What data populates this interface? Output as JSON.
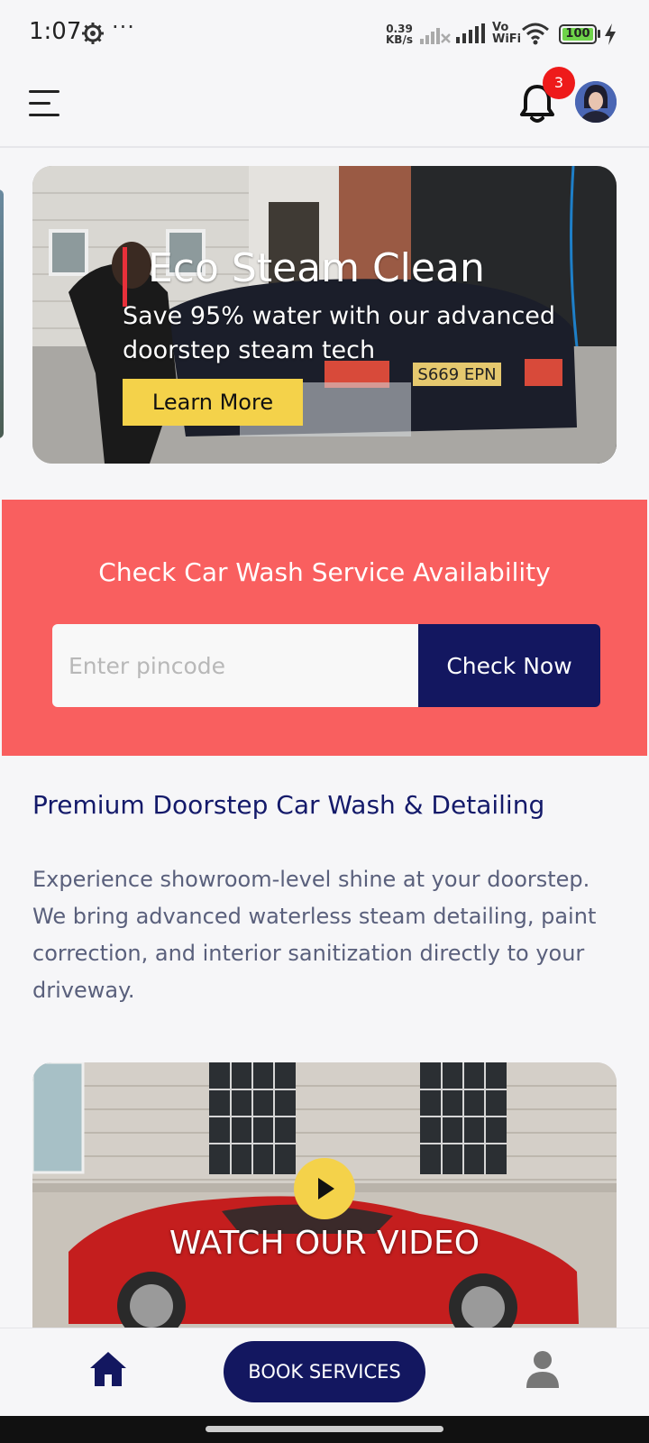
{
  "status_bar": {
    "time": "1:07",
    "more": "···",
    "speed_value": "0.39",
    "speed_unit": "KB/s",
    "vo": "Vo",
    "wifi": "WiFi",
    "battery": "100"
  },
  "header": {
    "notification_count": "3",
    "menu_icon": "menu-icon",
    "bell_icon": "bell-icon"
  },
  "hero": {
    "title": "Eco Steam Clean",
    "subtitle": "Save 95% water with our advanced doorstep steam tech",
    "button_label": "Learn More"
  },
  "availability": {
    "title": "Check Car Wash Service Availability",
    "pincode_placeholder": "Enter pincode",
    "pincode_value": "",
    "button_label": "Check Now"
  },
  "content": {
    "title": "Premium Doorstep Car Wash & Detailing",
    "body": "Experience showroom-level shine at your doorstep. We bring advanced waterless steam detailing, paint correction, and interior sanitization directly to your driveway."
  },
  "video": {
    "label": "WATCH OUR VIDEO"
  },
  "bottom_nav": {
    "book_label": "BOOK SERVICES",
    "home_icon": "home-icon",
    "profile_icon": "profile-icon"
  },
  "colors": {
    "navy": "#131760",
    "coral": "#f95f5f",
    "yellow": "#f4d24a",
    "badge_red": "#ee1a1a",
    "accent_red": "#e8303a"
  }
}
